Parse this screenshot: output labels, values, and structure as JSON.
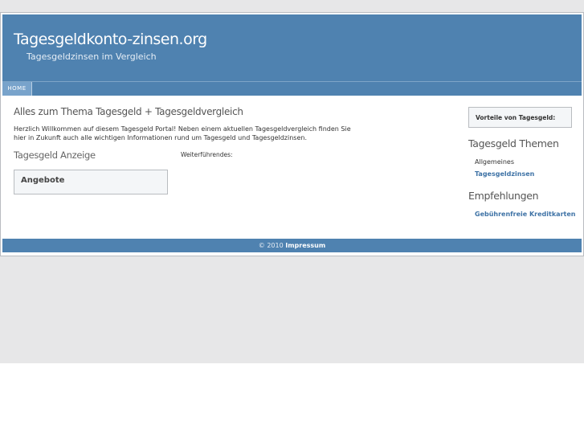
{
  "header": {
    "title": "Tagesgeldkonto-zinsen.org",
    "subtitle": "Tagesgeldzinsen im Vergleich"
  },
  "nav": {
    "items": [
      {
        "label": "HOME"
      }
    ]
  },
  "main": {
    "title": "Alles zum Thema Tagesgeld + Tagesgeldvergleich",
    "intro": "Herzlich Willkommen auf diesem Tagesgeld Portal! Neben einem aktuellen Tagesgeldvergleich finden Sie hier in Zukunft auch alle wichtigen Informationen rund um Tagesgeld und Tagesgeldzinsen.",
    "ad_title": "Tagesgeld Anzeige",
    "further_label": "Weiterführendes:",
    "offers_label": "Angebote"
  },
  "sidebar": {
    "box_label": "Vorteile von Tagesgeld:",
    "topics_heading": "Tagesgeld Themen",
    "topics": [
      {
        "label": "Allgemeines"
      },
      {
        "label": "Tagesgeldzinsen"
      }
    ],
    "recommend_heading": "Empfehlungen",
    "recommendations": [
      {
        "label": "Gebührenfreie Kreditkarten"
      }
    ]
  },
  "footer": {
    "copyright": "© 2010",
    "impressum": "Impressum"
  },
  "colors": {
    "header_blue": "#4f82b0",
    "nav_active": "#78a3cb",
    "link_blue": "#3f73a6",
    "page_gray": "#e7e7e8"
  }
}
